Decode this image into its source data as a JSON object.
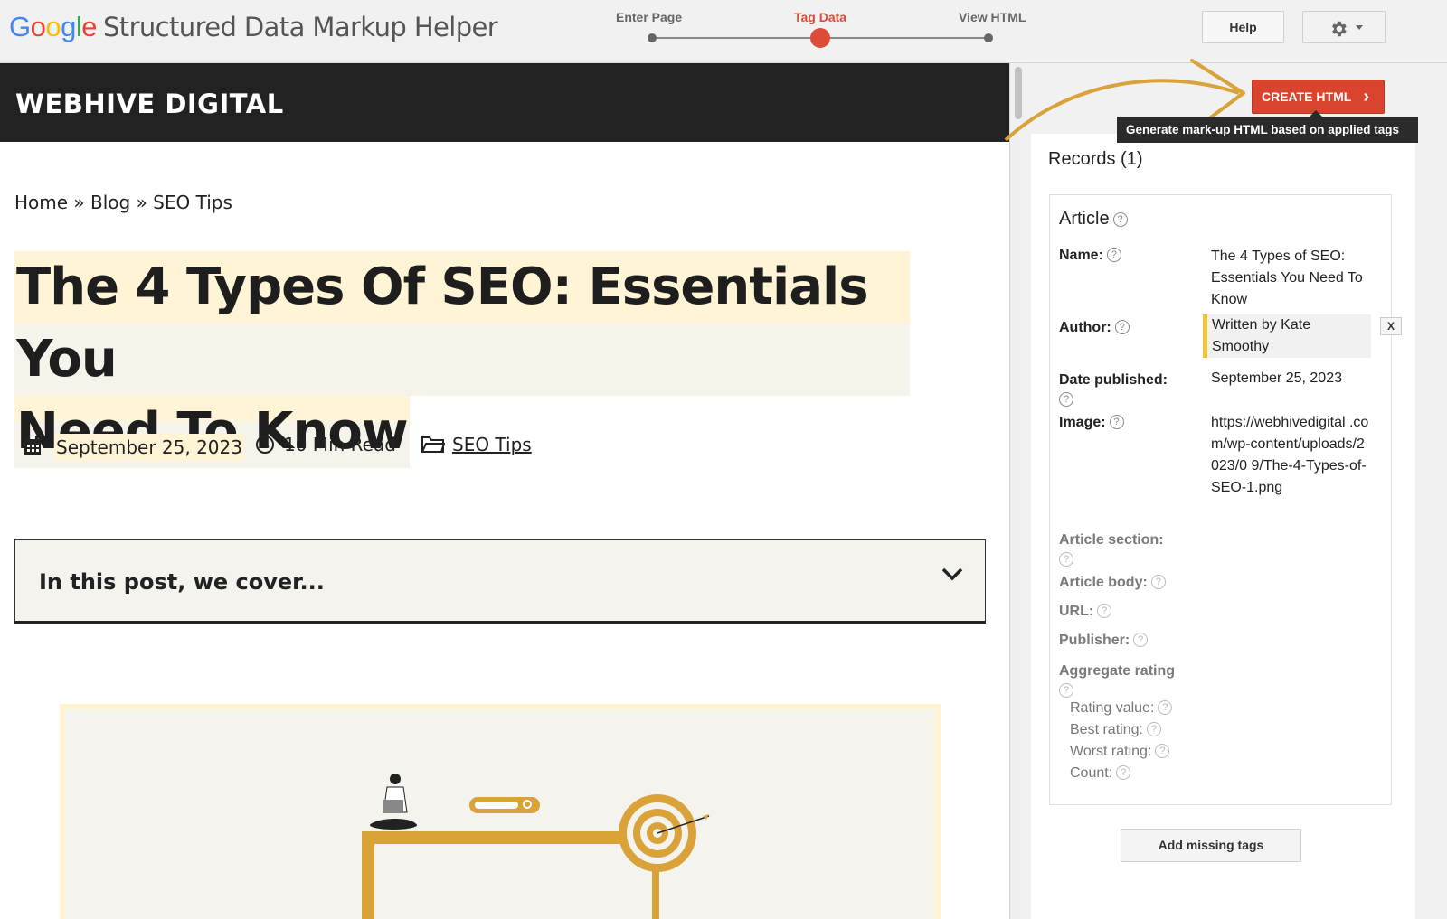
{
  "header": {
    "logo": {
      "g": "G",
      "o1": "o",
      "o2": "o",
      "g2": "g",
      "l": "l",
      "e": "e"
    },
    "app_title": "Structured Data Markup Helper",
    "steps": [
      {
        "label": "Enter Page",
        "active": false
      },
      {
        "label": "Tag Data",
        "active": true
      },
      {
        "label": "View HTML",
        "active": false
      }
    ],
    "help_label": "Help",
    "settings_icon": "gear-icon"
  },
  "page": {
    "site_name": "WEBHIVE DIGITAL",
    "breadcrumb": "Home » Blog » SEO Tips",
    "title_line1": "The 4 Types Of SEO: Essentials You",
    "title_line2": "Need To Know",
    "meta": {
      "date": "September 25, 2023",
      "read_time": "10 Min Read",
      "category": "SEO Tips"
    },
    "toc_label": "In this post, we cover...",
    "accent_color": "#d9a33a"
  },
  "panel": {
    "create_html_label": "CREATE HTML",
    "tooltip": "Generate mark-up HTML based on applied tags",
    "records_heading": "Records (1)",
    "record": {
      "type": "Article",
      "fields": {
        "name_label": "Name:",
        "name_value": "The 4 Types of SEO: Essentials You Need To Know",
        "author_label": "Author:",
        "author_value": "Written by Kate Smoothy",
        "date_label": "Date published:",
        "date_value": "September 25, 2023",
        "image_label": "Image:",
        "image_value": "https://webhivedigital .com/wp-content/uploads/2023/0 9/The-4-Types-of-SEO-1.png",
        "section_label": "Article section:",
        "body_label": "Article body:",
        "url_label": "URL:",
        "publisher_label": "Publisher:",
        "rating_label": "Aggregate rating",
        "rating_value_label": "Rating value:",
        "best_rating_label": "Best rating:",
        "worst_rating_label": "Worst rating:",
        "count_label": "Count:"
      },
      "remove_label": "X"
    },
    "add_missing_label": "Add missing tags",
    "highlight_color": "#f4c430"
  }
}
